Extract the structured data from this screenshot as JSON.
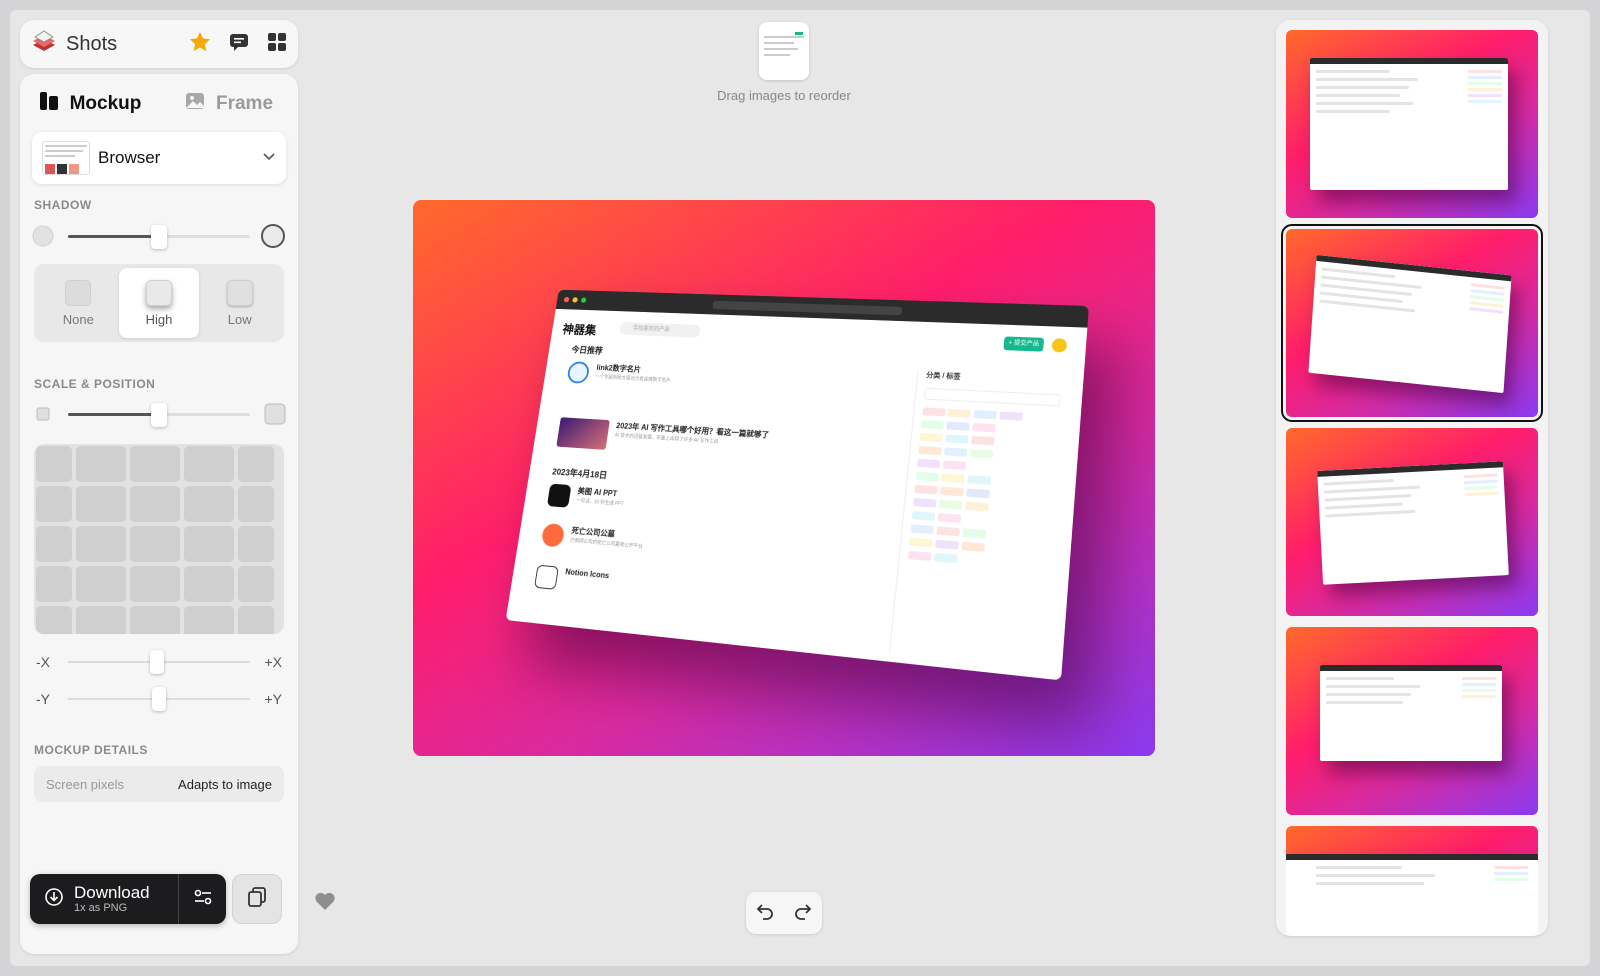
{
  "app": {
    "name": "Shots",
    "icons": [
      "star-icon",
      "chat-icon",
      "grid-icon"
    ]
  },
  "tabs": [
    {
      "label": "Mockup",
      "icon": "mockup-icon",
      "active": true
    },
    {
      "label": "Frame",
      "icon": "image-icon",
      "active": false
    }
  ],
  "device": {
    "selected": "Browser"
  },
  "shadow": {
    "label": "SHADOW",
    "level": 0.5,
    "options": [
      {
        "label": "None",
        "active": false
      },
      {
        "label": "High",
        "active": true
      },
      {
        "label": "Low",
        "active": false
      }
    ]
  },
  "scale_position": {
    "label": "SCALE & POSITION",
    "scale": 0.5,
    "x_axis": {
      "min_label": "-X",
      "max_label": "+X",
      "value": 0.49
    },
    "y_axis": {
      "min_label": "-Y",
      "max_label": "+Y",
      "value": 0.5
    }
  },
  "mockup_details": {
    "label": "MOCKUP DETAILS",
    "key": "Screen pixels",
    "value": "Adapts to image"
  },
  "download": {
    "label": "Download",
    "sub": "1x as PNG"
  },
  "canvas": {
    "reorder_hint": "Drag images to reorder",
    "gradient": [
      "#ff6a2b",
      "#ff1d6b",
      "#d92aa0",
      "#8a3af2"
    ],
    "screenshot": {
      "logo": "神器集",
      "search_placeholder": "寻找喜欢的产品",
      "submit_button": "+ 提交产品",
      "today_heading": "今日推荐",
      "date_heading": "2023年4月18日",
      "items": [
        {
          "title": "link2数字名片",
          "desc": "一个专属你的方便对方看连接数字名片"
        },
        {
          "title": "2023年 AI 写作工具哪个好用？看这一篇就够了",
          "desc": "AI 技术的迅猛发展，市面上出现了许多 AI 写作工具"
        },
        {
          "title": "美图 AI PPT",
          "desc": "一句话，10 秒生成 PPT"
        },
        {
          "title": "死亡公司公墓",
          "desc": "已倒闭公司的死亡公司墓地公开平台"
        },
        {
          "title": "Notion Icons",
          "desc": ""
        }
      ],
      "side_heading": "分类 / 标签"
    }
  },
  "history": {
    "undo_icon": "undo-icon",
    "redo_icon": "redo-icon"
  },
  "variants": [
    {
      "name": "variant-1",
      "selected": false
    },
    {
      "name": "variant-2",
      "selected": true
    },
    {
      "name": "variant-3",
      "selected": false
    },
    {
      "name": "variant-4",
      "selected": false
    },
    {
      "name": "variant-5",
      "selected": false
    }
  ]
}
